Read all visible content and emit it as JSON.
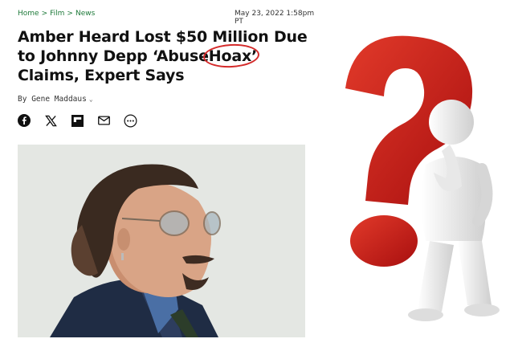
{
  "breadcrumb": {
    "items": [
      "Home",
      "Film",
      "News"
    ],
    "separator": ">"
  },
  "date": "May 23, 2022 1:58pm PT",
  "headline": {
    "before": "Amber Heard Lost $50 Million Due to Johnny Depp ‘Abuse",
    "circled": "Hoax",
    "after": "’ Claims, Expert Says"
  },
  "byline": {
    "prefix": "By",
    "author": "Gene Maddaus"
  },
  "share_icons": [
    "facebook-icon",
    "x-icon",
    "flipboard-icon",
    "email-icon",
    "more-icon"
  ],
  "colors": {
    "breadcrumb": "#1e7a3a",
    "circle": "#d42a2a",
    "question_mark": "#d11a1a"
  }
}
